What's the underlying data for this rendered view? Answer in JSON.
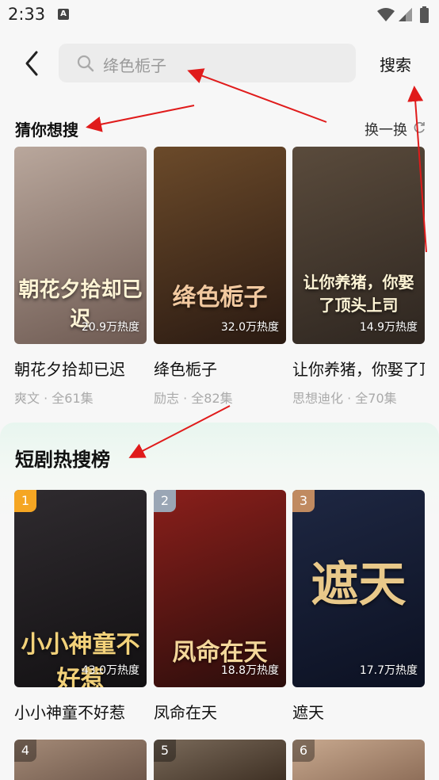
{
  "status_bar": {
    "time": "2:33",
    "badge": "A"
  },
  "header": {
    "search_placeholder": "绛色栀子",
    "search_button": "搜索"
  },
  "guess": {
    "title": "猜你想搜",
    "refresh_label": "换一换",
    "items": [
      {
        "title": "朝花夕拾却已迟",
        "meta": "爽文 · 全61集",
        "heat": "20.9万热度",
        "cover_text": "朝花夕拾却已迟",
        "colors": [
          "#b9a79c",
          "#6e5a52"
        ]
      },
      {
        "title": "绛色栀子",
        "meta": "励志 · 全82集",
        "heat": "32.0万热度",
        "cover_text": "绛色栀子",
        "colors": [
          "#6b4a2a",
          "#2a1a12"
        ]
      },
      {
        "title": "让你养猪，你娶了顶头上司",
        "meta": "思想迪化 · 全70集",
        "heat": "14.9万热度",
        "cover_text": "让你养猪，你娶了顶头上司",
        "colors": [
          "#5a4b3c",
          "#2e2620"
        ]
      }
    ]
  },
  "hot": {
    "title": "短剧热搜榜",
    "items": [
      {
        "rank": "1",
        "title": "小小神童不好惹",
        "heat": "43.0万热度",
        "cover_text": "小小神童不好惹",
        "rank_color": "#f5a623",
        "colors": [
          "#2f2b2f",
          "#121012"
        ]
      },
      {
        "rank": "2",
        "title": "凤命在天",
        "heat": "18.8万热度",
        "cover_text": "凤命在天",
        "rank_color": "#9aa6b5",
        "colors": [
          "#8a1f1b",
          "#2a0d0b"
        ]
      },
      {
        "rank": "3",
        "title": "遮天",
        "heat": "17.7万热度",
        "cover_text": "遮天",
        "rank_color": "#c08a60",
        "colors": [
          "#1e2742",
          "#0c1122"
        ]
      }
    ],
    "more": [
      {
        "rank": "4",
        "colors": [
          "#a48a77",
          "#6a5447"
        ]
      },
      {
        "rank": "5",
        "colors": [
          "#7a6a5a",
          "#3a2c20"
        ]
      },
      {
        "rank": "6",
        "colors": [
          "#c8a98f",
          "#8a6a55"
        ]
      }
    ]
  },
  "icons": {
    "back": "chevron-left-icon",
    "search": "search-icon",
    "refresh": "refresh-icon",
    "wifi": "wifi-icon",
    "cell": "cellular-icon",
    "battery": "battery-icon"
  },
  "annotation_color": "#e01b1b"
}
